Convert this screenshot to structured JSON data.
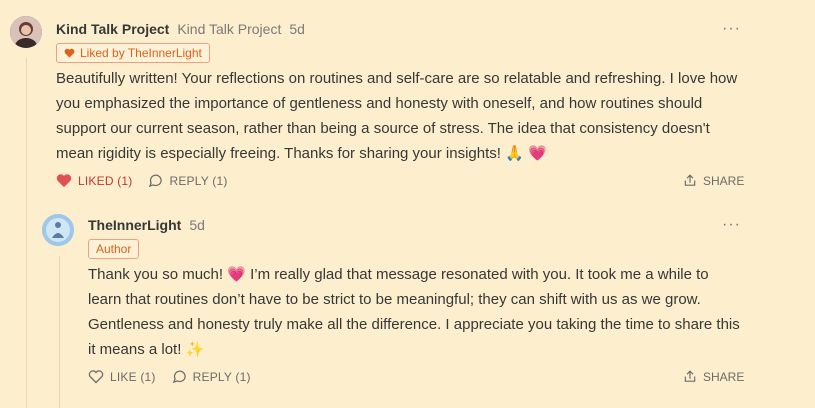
{
  "comment": {
    "author": "Kind Talk Project",
    "author_sub": "Kind Talk Project",
    "time": "5d",
    "badge": "Liked by TheInnerLight",
    "lines": [
      "Beautifully written! Your reflections on routines and self-care are so relatable and refreshing. I love how",
      "you emphasized the importance of gentleness and honesty with oneself, and how routines should",
      "support our current season, rather than being a source of stress. The idea that consistency doesn't",
      "mean rigidity is especially freeing. Thanks for sharing your insights! 🙏 💗"
    ],
    "like_label": "LIKED (1)",
    "reply_label": "REPLY (1)",
    "share_label": "SHARE",
    "more": "···"
  },
  "reply": {
    "author": "TheInnerLight",
    "time": "5d",
    "badge": "Author",
    "lines": [
      "Thank you so much! 💗  I’m really glad that message resonated with you. It took me a while to",
      "learn that routines don’t have to be strict to be meaningful; they can shift with us as we grow.",
      "Gentleness and honesty truly make all the difference. I appreciate you taking the time to share this",
      "it means a lot! ✨"
    ],
    "like_label": "LIKE (1)",
    "reply_label": "REPLY (1)",
    "share_label": "SHARE",
    "more": "···"
  },
  "colors": {
    "background": "#fdefce",
    "accent": "#e0601a",
    "liked": "#c0392b"
  },
  "icons": [
    "heart-icon",
    "comment-bubble-icon",
    "share-icon",
    "more-dots-icon"
  ]
}
